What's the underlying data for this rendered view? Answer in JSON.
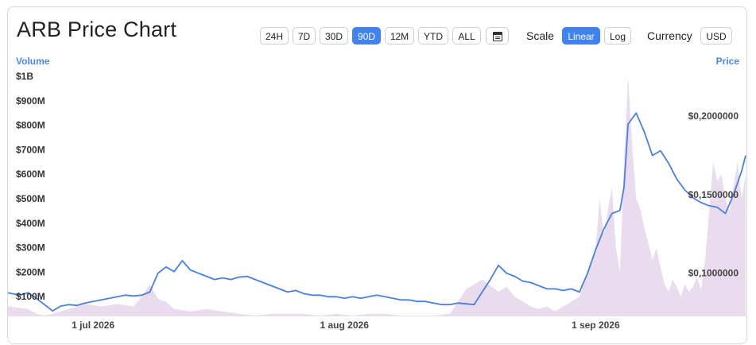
{
  "title": "ARB Price Chart",
  "ranges": [
    {
      "label": "24H",
      "active": false
    },
    {
      "label": "7D",
      "active": false
    },
    {
      "label": "30D",
      "active": false
    },
    {
      "label": "90D",
      "active": true
    },
    {
      "label": "12M",
      "active": false
    },
    {
      "label": "YTD",
      "active": false
    },
    {
      "label": "ALL",
      "active": false
    }
  ],
  "calendar_icon": "calendar-icon",
  "scale": {
    "label": "Scale",
    "options": [
      {
        "label": "Linear",
        "active": true
      },
      {
        "label": "Log",
        "active": false
      }
    ]
  },
  "currency": {
    "label": "Currency",
    "value": "USD"
  },
  "colors": {
    "accent": "#3f82f0",
    "line": "#4a7fe0",
    "volume": "#eadcef",
    "axis_title": "#4a86e8"
  },
  "chart_data": {
    "type": "line",
    "left_axis": {
      "title": "Volume",
      "ticks": [
        "$100M",
        "$200M",
        "$300M",
        "$400M",
        "$500M",
        "$600M",
        "$700M",
        "$800M",
        "$900M",
        "$1B"
      ],
      "ylim": [
        0,
        1000000000
      ]
    },
    "right_axis": {
      "title": "Price",
      "ticks": [
        "$0,1000000",
        "$0,1500000",
        "$0,2000000"
      ],
      "ylim": [
        0.073,
        0.233
      ]
    },
    "x_ticks": [
      "1 jul 2026",
      "1 aug 2026",
      "1 sep 2026"
    ],
    "x_tick_days": [
      0,
      31,
      62
    ],
    "x_range_days": [
      -10.5,
      80.5
    ],
    "price_series": {
      "name": "Price",
      "x": [
        -10.5,
        -10,
        -9,
        -8,
        -7,
        -6,
        -5,
        -4,
        -3,
        -2,
        -1,
        0,
        1,
        2,
        3,
        4,
        5,
        6,
        7,
        8,
        9,
        10,
        11,
        12,
        13,
        14,
        15,
        16,
        17,
        18,
        19,
        20,
        21,
        22,
        23,
        24,
        25,
        26,
        27,
        28,
        29,
        30,
        31,
        32,
        33,
        34,
        35,
        36,
        37,
        38,
        39,
        40,
        41,
        42,
        43,
        44,
        45,
        46,
        47,
        48,
        49,
        50,
        51,
        52,
        53,
        54,
        55,
        56,
        57,
        58,
        59,
        60,
        61,
        62,
        63,
        64,
        65,
        65.5,
        66,
        67,
        68,
        69,
        70,
        71,
        72,
        73,
        74,
        75,
        76,
        77,
        78,
        79,
        80,
        80.5
      ],
      "y": [
        0.0875,
        0.087,
        0.086,
        0.0875,
        0.084,
        0.08,
        0.076,
        0.079,
        0.08,
        0.0795,
        0.081,
        0.082,
        0.083,
        0.084,
        0.085,
        0.086,
        0.0855,
        0.086,
        0.088,
        0.1,
        0.104,
        0.101,
        0.108,
        0.102,
        0.1,
        0.098,
        0.096,
        0.097,
        0.096,
        0.0975,
        0.098,
        0.096,
        0.094,
        0.092,
        0.09,
        0.088,
        0.089,
        0.087,
        0.086,
        0.086,
        0.085,
        0.085,
        0.084,
        0.085,
        0.084,
        0.085,
        0.086,
        0.085,
        0.084,
        0.083,
        0.083,
        0.082,
        0.082,
        0.081,
        0.08,
        0.08,
        0.081,
        0.0805,
        0.08,
        0.088,
        0.096,
        0.105,
        0.1,
        0.098,
        0.095,
        0.094,
        0.092,
        0.09,
        0.09,
        0.089,
        0.09,
        0.088,
        0.1,
        0.115,
        0.128,
        0.138,
        0.14,
        0.155,
        0.195,
        0.202,
        0.19,
        0.175,
        0.178,
        0.17,
        0.16,
        0.153,
        0.148,
        0.145,
        0.143,
        0.142,
        0.138,
        0.15,
        0.165,
        0.175,
        0.205
      ]
    },
    "volume_series": {
      "name": "Volume",
      "x": [
        -10.5,
        -8,
        -7,
        -6,
        -5,
        -3,
        -1,
        1,
        3,
        5,
        6,
        7,
        8,
        9,
        10,
        12,
        14,
        16,
        18,
        20,
        22,
        24,
        26,
        28,
        30,
        32,
        34,
        36,
        38,
        40,
        42,
        44,
        46,
        48,
        50,
        51,
        52,
        53,
        54,
        55,
        56,
        57,
        58,
        59,
        60,
        61,
        62,
        62.5,
        63,
        63.5,
        64,
        64.5,
        65,
        65.5,
        66,
        66.5,
        67,
        67.5,
        68,
        68.5,
        69,
        69.5,
        70,
        70.5,
        71,
        71.5,
        72,
        72.5,
        73,
        73.5,
        74,
        74.5,
        75,
        75.5,
        76,
        76.5,
        77,
        77.5,
        78,
        78.5,
        79,
        79.5,
        80,
        80.5
      ],
      "y": [
        60000000,
        50000000,
        30000000,
        20000000,
        30000000,
        50000000,
        70000000,
        60000000,
        70000000,
        60000000,
        100000000,
        150000000,
        90000000,
        80000000,
        50000000,
        40000000,
        50000000,
        40000000,
        30000000,
        20000000,
        30000000,
        30000000,
        30000000,
        20000000,
        30000000,
        20000000,
        30000000,
        30000000,
        20000000,
        10000000,
        20000000,
        30000000,
        130000000,
        170000000,
        120000000,
        140000000,
        100000000,
        80000000,
        60000000,
        50000000,
        60000000,
        40000000,
        60000000,
        80000000,
        100000000,
        200000000,
        300000000,
        500000000,
        350000000,
        450000000,
        550000000,
        300000000,
        200000000,
        650000000,
        1000000000,
        720000000,
        500000000,
        460000000,
        380000000,
        320000000,
        250000000,
        300000000,
        220000000,
        150000000,
        120000000,
        170000000,
        140000000,
        100000000,
        150000000,
        120000000,
        140000000,
        180000000,
        130000000,
        250000000,
        450000000,
        650000000,
        570000000,
        600000000,
        500000000,
        450000000,
        550000000,
        650000000,
        500000000,
        600000000
      ]
    }
  }
}
